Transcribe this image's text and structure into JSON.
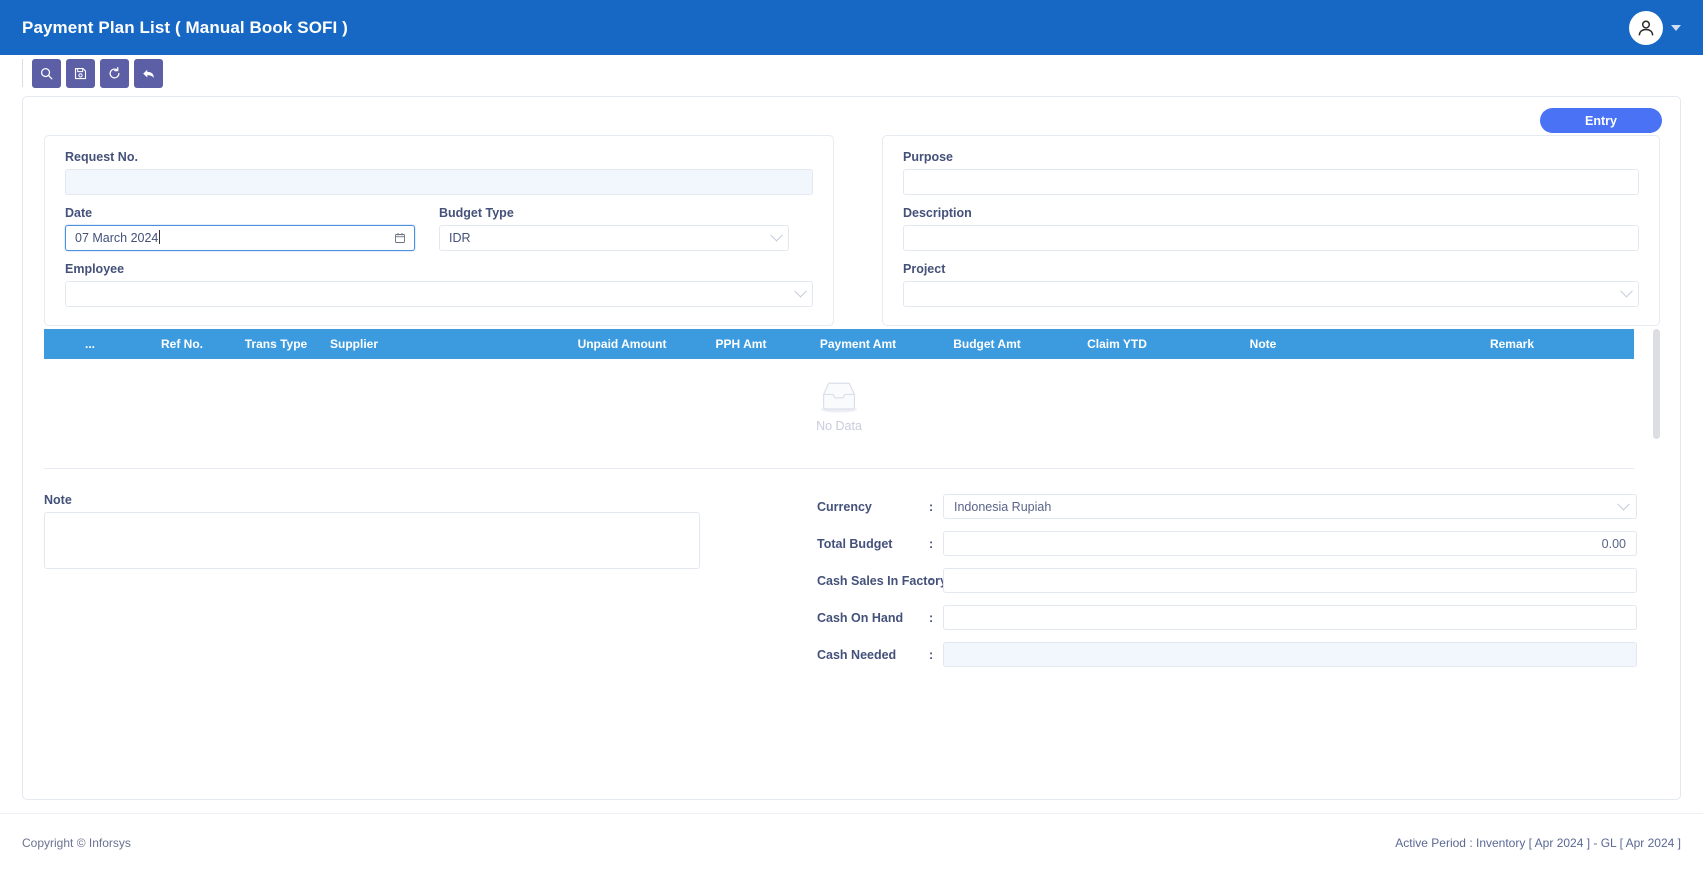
{
  "header": {
    "title": "Payment Plan List ( Manual Book SOFI )",
    "avatar_icon": "user-icon",
    "caret_icon": "caret-down-icon"
  },
  "toolbar": {
    "buttons": [
      {
        "name": "search",
        "icon": "search-icon",
        "label": "Search"
      },
      {
        "name": "save",
        "icon": "save-icon",
        "label": "Save"
      },
      {
        "name": "refresh",
        "icon": "refresh-icon",
        "label": "Refresh"
      },
      {
        "name": "back",
        "icon": "back-arrow-icon",
        "label": "Back"
      }
    ]
  },
  "actions": {
    "entry_label": "Entry"
  },
  "form": {
    "left": {
      "request_no": {
        "label": "Request No.",
        "value": "",
        "placeholder": ""
      },
      "date": {
        "label": "Date",
        "value": "07 March 2024",
        "icon": "calendar-icon"
      },
      "budget_type": {
        "label": "Budget Type",
        "value": "IDR",
        "icon": "chevron-down-icon"
      },
      "employee": {
        "label": "Employee",
        "value": "",
        "icon": "chevron-down-icon"
      }
    },
    "right": {
      "purpose": {
        "label": "Purpose",
        "value": ""
      },
      "description": {
        "label": "Description",
        "value": ""
      },
      "project": {
        "label": "Project",
        "value": "",
        "icon": "chevron-down-icon"
      }
    }
  },
  "table": {
    "columns": [
      "...",
      "Ref No.",
      "Trans Type",
      "Supplier",
      "Unpaid Amount",
      "PPH Amt",
      "Payment Amt",
      "Budget Amt",
      "Claim YTD",
      "Note",
      "Remark"
    ],
    "rows": [],
    "empty_text": "No Data",
    "empty_icon": "inbox-icon"
  },
  "note": {
    "label": "Note",
    "value": "",
    "placeholder": ""
  },
  "summary": {
    "rows": [
      {
        "label": "Currency",
        "colon": ":",
        "value": "Indonesia Rupiah",
        "type": "select",
        "readonly": false,
        "align": "left"
      },
      {
        "label": "Total Budget",
        "colon": ":",
        "value": "0.00",
        "type": "text",
        "readonly": false,
        "align": "right"
      },
      {
        "label": "Cash Sales In Factory",
        "colon": ":",
        "value": "",
        "type": "text",
        "readonly": false,
        "align": "left"
      },
      {
        "label": "Cash On Hand",
        "colon": ":",
        "value": "",
        "type": "text",
        "readonly": false,
        "align": "left"
      },
      {
        "label": "Cash Needed",
        "colon": ":",
        "value": "",
        "type": "text",
        "readonly": true,
        "align": "left"
      }
    ]
  },
  "footer": {
    "copyright": "Copyright © Inforsys",
    "active_period": "Active Period  :  Inventory [ Apr 2024 ]  -  GL [ Apr 2024 ]"
  },
  "colors": {
    "header_blue": "#1668c4",
    "toolbar_button": "#5c5fa6",
    "entry_blue": "#4a72f5",
    "table_header_blue": "#3c9bdf",
    "label_navy": "#44517a",
    "readonly_bg": "#f2f7fd"
  }
}
